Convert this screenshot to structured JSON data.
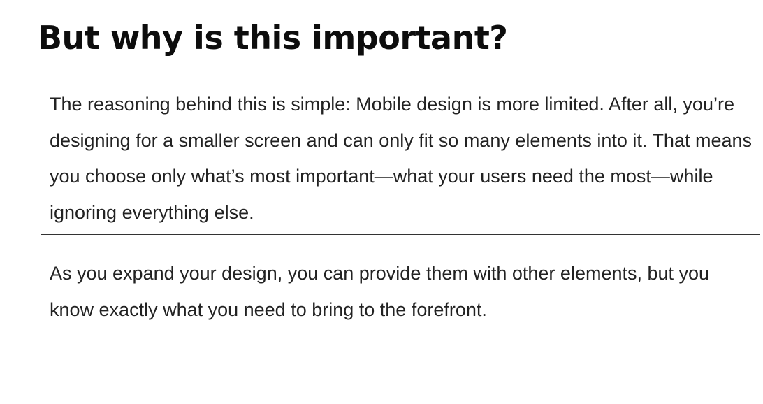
{
  "heading": "But why is this important?",
  "paragraphs": [
    "The reasoning behind this is simple: Mobile design is more limited. After all, you’re designing for a smaller screen and can only fit so many elements into it. That means you choose only what’s most important—what your users need the most—while ignoring everything else.",
    "As you expand your design, you can provide them with other elements, but you know exactly what you need to bring to the forefront."
  ]
}
